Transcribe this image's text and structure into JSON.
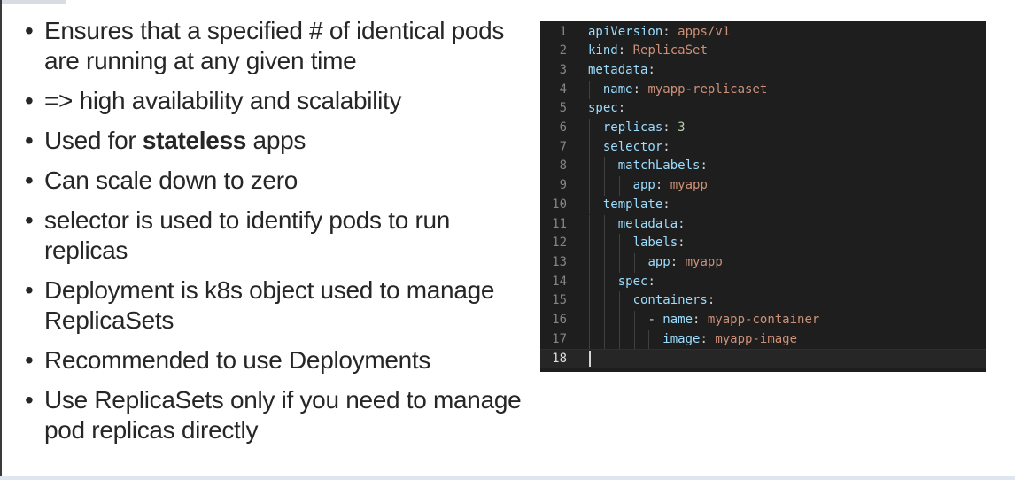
{
  "bullets": [
    {
      "parts": [
        {
          "text": "Ensures that a specified # of identical pods are running at any given time",
          "bold": false
        }
      ]
    },
    {
      "parts": [
        {
          "text": "=> high availability and scalability",
          "bold": false
        }
      ]
    },
    {
      "parts": [
        {
          "text": "Used for ",
          "bold": false
        },
        {
          "text": "stateless",
          "bold": true
        },
        {
          "text": " apps",
          "bold": false
        }
      ]
    },
    {
      "parts": [
        {
          "text": "Can scale down to zero",
          "bold": false
        }
      ]
    },
    {
      "parts": [
        {
          "text": "selector is used to identify pods to run replicas",
          "bold": false
        }
      ]
    },
    {
      "parts": [
        {
          "text": "Deployment is k8s object used to manage ReplicaSets",
          "bold": false
        }
      ]
    },
    {
      "parts": [
        {
          "text": "Recommended to use Deployments",
          "bold": false
        }
      ]
    },
    {
      "parts": [
        {
          "text": "Use ReplicaSets only if you need to manage pod replicas directly",
          "bold": false
        }
      ]
    }
  ],
  "bullet_symbol": "•",
  "editor": {
    "active_line": 18,
    "colors": {
      "background": "#1e1e1e",
      "key": "#9cdcfe",
      "string": "#ce9178",
      "number": "#b5cea8",
      "punctuation": "#d4d4d4",
      "line_number": "#858585"
    },
    "lines": [
      {
        "num": "1",
        "indent": 0,
        "key": "apiVersion",
        "dash": false,
        "value": "apps/v1",
        "vtype": "s"
      },
      {
        "num": "2",
        "indent": 0,
        "key": "kind",
        "dash": false,
        "value": "ReplicaSet",
        "vtype": "s"
      },
      {
        "num": "3",
        "indent": 0,
        "key": "metadata",
        "dash": false,
        "value": "",
        "vtype": "s"
      },
      {
        "num": "4",
        "indent": 1,
        "key": "name",
        "dash": false,
        "value": "myapp-replicaset",
        "vtype": "s"
      },
      {
        "num": "5",
        "indent": 0,
        "key": "spec",
        "dash": false,
        "value": "",
        "vtype": "s"
      },
      {
        "num": "6",
        "indent": 1,
        "key": "replicas",
        "dash": false,
        "value": "3",
        "vtype": "n"
      },
      {
        "num": "7",
        "indent": 1,
        "key": "selector",
        "dash": false,
        "value": "",
        "vtype": "s"
      },
      {
        "num": "8",
        "indent": 2,
        "key": "matchLabels",
        "dash": false,
        "value": "",
        "vtype": "s"
      },
      {
        "num": "9",
        "indent": 3,
        "key": "app",
        "dash": false,
        "value": "myapp",
        "vtype": "s"
      },
      {
        "num": "10",
        "indent": 1,
        "key": "template",
        "dash": false,
        "value": "",
        "vtype": "s"
      },
      {
        "num": "11",
        "indent": 2,
        "key": "metadata",
        "dash": false,
        "value": "",
        "vtype": "s"
      },
      {
        "num": "12",
        "indent": 3,
        "key": "labels",
        "dash": false,
        "value": "",
        "vtype": "s"
      },
      {
        "num": "13",
        "indent": 4,
        "key": "app",
        "dash": false,
        "value": "myapp",
        "vtype": "s"
      },
      {
        "num": "14",
        "indent": 2,
        "key": "spec",
        "dash": false,
        "value": "",
        "vtype": "s"
      },
      {
        "num": "15",
        "indent": 3,
        "key": "containers",
        "dash": false,
        "value": "",
        "vtype": "s"
      },
      {
        "num": "16",
        "indent": 4,
        "key": "name",
        "dash": true,
        "value": "myapp-container",
        "vtype": "s"
      },
      {
        "num": "17",
        "indent": 5,
        "key": "image",
        "dash": false,
        "value": "myapp-image",
        "vtype": "s"
      },
      {
        "num": "18",
        "indent": 0,
        "key": "",
        "dash": false,
        "value": "",
        "vtype": "s"
      }
    ]
  }
}
